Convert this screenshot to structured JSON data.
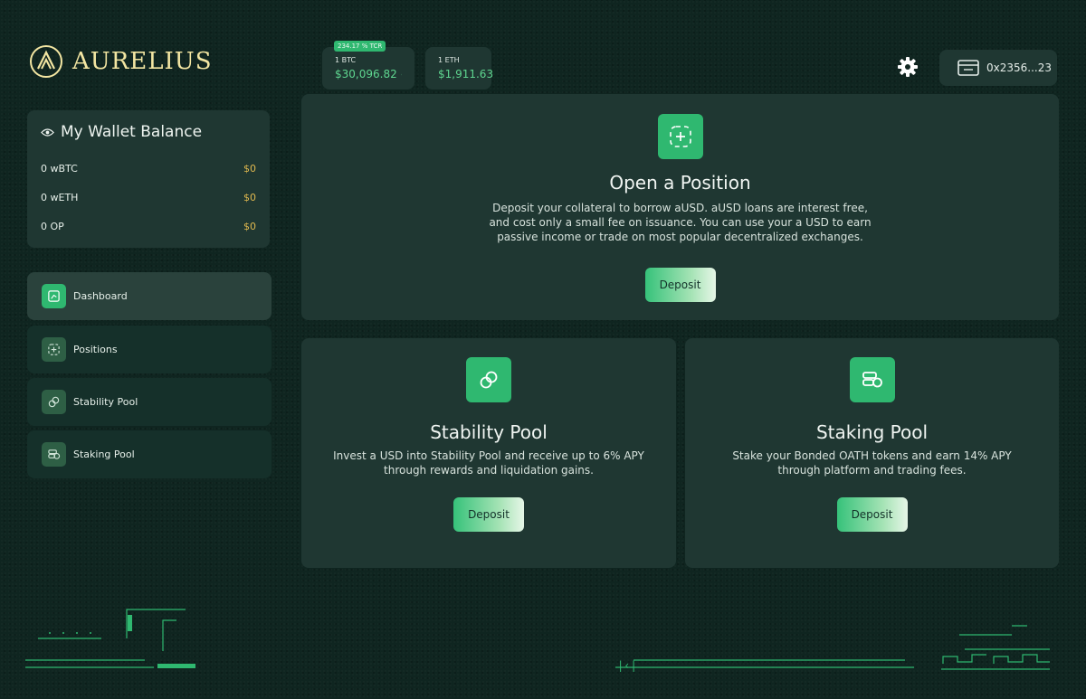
{
  "brand": {
    "name": "AURELIUS"
  },
  "prices": {
    "tcr_badge": "234.17 % TCR",
    "btc_label": "1 BTC",
    "btc_value": "$30,096.82",
    "eth_label": "1 ETH",
    "eth_value": "$1,911.63"
  },
  "header": {
    "wallet_address": "0x2356...23"
  },
  "wallet_balance": {
    "title": "My Wallet Balance",
    "rows": [
      {
        "token": "0 wBTC",
        "value": "$0"
      },
      {
        "token": "0 wETH",
        "value": "$0"
      },
      {
        "token": "0 OP",
        "value": "$0"
      }
    ]
  },
  "nav": {
    "items": [
      {
        "label": "Dashboard",
        "active": true
      },
      {
        "label": "Positions"
      },
      {
        "label": "Stability Pool"
      },
      {
        "label": "Staking Pool"
      }
    ]
  },
  "cards": {
    "open": {
      "title": "Open a Position",
      "desc": "Deposit your collateral to borrow aUSD. aUSD loans are interest free, and cost only a small fee on issuance. You can use your a USD to earn passive income or trade on most popular decentralized exchanges.",
      "button": "Deposit"
    },
    "stability": {
      "title": "Stability Pool",
      "desc": "Invest a USD into Stability Pool and receive up to 6% APY through rewards and liquidation gains.",
      "button": "Deposit"
    },
    "staking": {
      "title": "Staking Pool",
      "desc": "Stake your Bonded OATH tokens and earn 14% APY through platform and trading fees.",
      "button": "Deposit"
    }
  },
  "colors": {
    "accent": "#2fb870",
    "gold": "#e0b94f",
    "card": "#1f3732",
    "background": "#0f2520"
  }
}
